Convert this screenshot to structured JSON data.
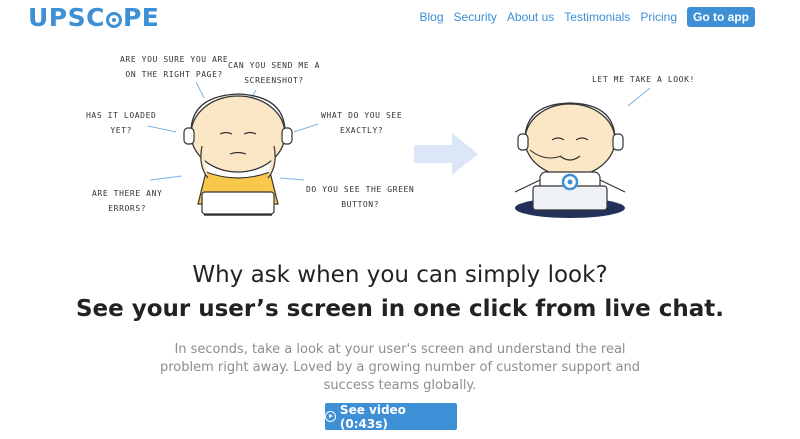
{
  "header": {
    "logo_pre": "UPSC",
    "logo_post": "PE",
    "nav": [
      "Blog",
      "Security",
      "About us",
      "Testimonials",
      "Pricing"
    ],
    "cta": "Go to app"
  },
  "illustration": {
    "bubbles": {
      "right_page": "ARE YOU SURE YOU ARE\nON THE RIGHT PAGE?",
      "screenshot": "CAN YOU SEND ME A\nSCREENSHOT?",
      "loaded": "HAS IT LOADED\nYET?",
      "what_see": "WHAT DO YOU SEE\nEXACTLY?",
      "errors": "ARE THERE ANY\nERRORS?",
      "green_button": "DO YOU SEE THE GREEN\nBUTTON?",
      "take_look": "LET ME TAKE A LOOK!"
    }
  },
  "hero": {
    "headline": "Why ask when you can simply look?",
    "subhead": "See your user’s screen in one click from live chat.",
    "description": "In seconds, take a look at your user's screen and understand the real problem right away. Loved by a growing number of customer support and success teams globally.",
    "video_button": "See video (0:43s)"
  },
  "colors": {
    "brand": "#3d8fd6",
    "shirt": "#f8c84a",
    "skin": "#fbe7c6",
    "arrow": "#dbe6f7",
    "muted_text": "#8d8d8d"
  }
}
